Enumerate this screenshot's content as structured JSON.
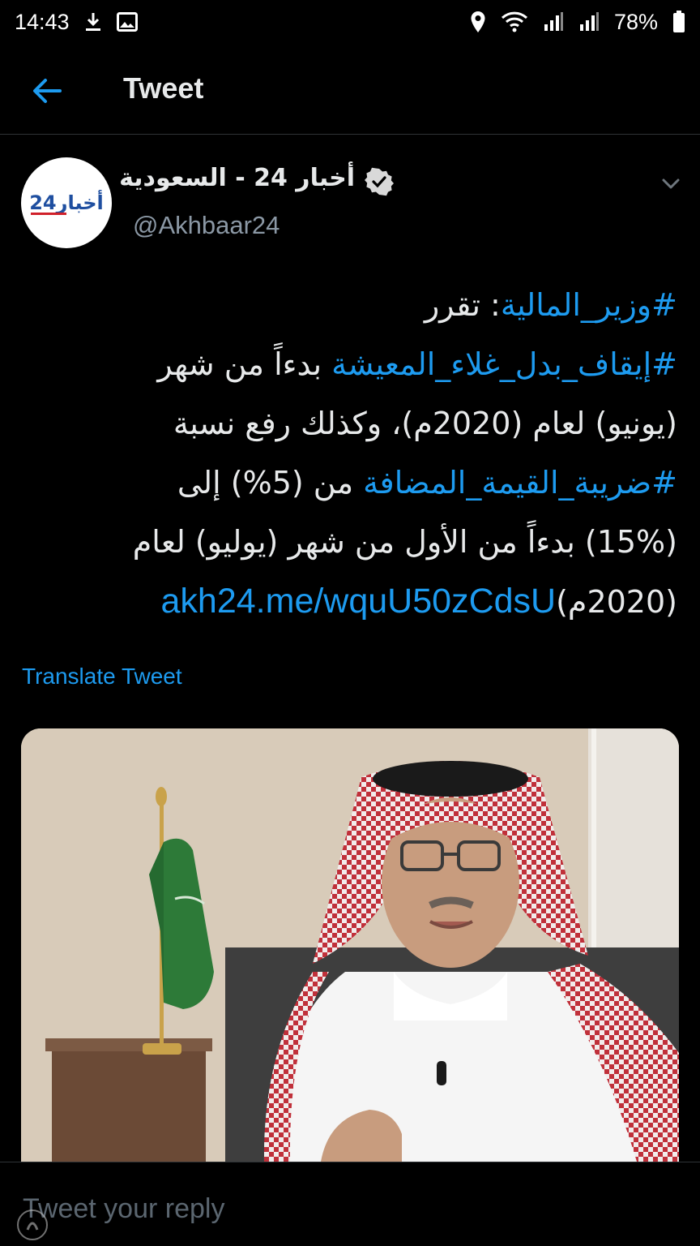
{
  "status_bar": {
    "time": "14:43",
    "battery": "78%",
    "left_icons": [
      "download-icon",
      "image-icon"
    ],
    "right_icons": [
      "location-icon",
      "wifi-icon",
      "signal-icon",
      "signal-icon",
      "battery-icon"
    ]
  },
  "header": {
    "title": "Tweet",
    "back_icon": "arrow-left-icon"
  },
  "tweet": {
    "author": {
      "display_name": "أخبار 24 - السعودية",
      "handle": "@Akhbaar24",
      "verified": true,
      "avatar_logo_text": "أخبار24"
    },
    "text_lines": {
      "l1": {
        "hashtag": "#وزير_المالية",
        "text": ": تقرر"
      },
      "l2": {
        "hashtag": "#إيقاف_بدل_غلاء_المعيشة",
        "text": " بدءاً من شهر"
      },
      "l3": {
        "text": "(يونيو) لعام (2020م)، وكذلك رفع نسبة"
      },
      "l4": {
        "hashtag": "#ضريبة_القيمة_المضافة",
        "text": " من (5%) إلى"
      },
      "l5": {
        "text": "(15%) بدءاً من الأول من شهر (يوليو) لعام"
      },
      "l6": {
        "text": "(2020م)",
        "link": "akh24.me/wquU50zCdsU"
      }
    },
    "translate_label": "Translate Tweet"
  },
  "reply": {
    "placeholder": "Tweet your reply"
  },
  "colors": {
    "accent": "#1d9bf0",
    "background": "#000000",
    "secondary_text": "#8b98a5",
    "divider": "#2f3336"
  }
}
